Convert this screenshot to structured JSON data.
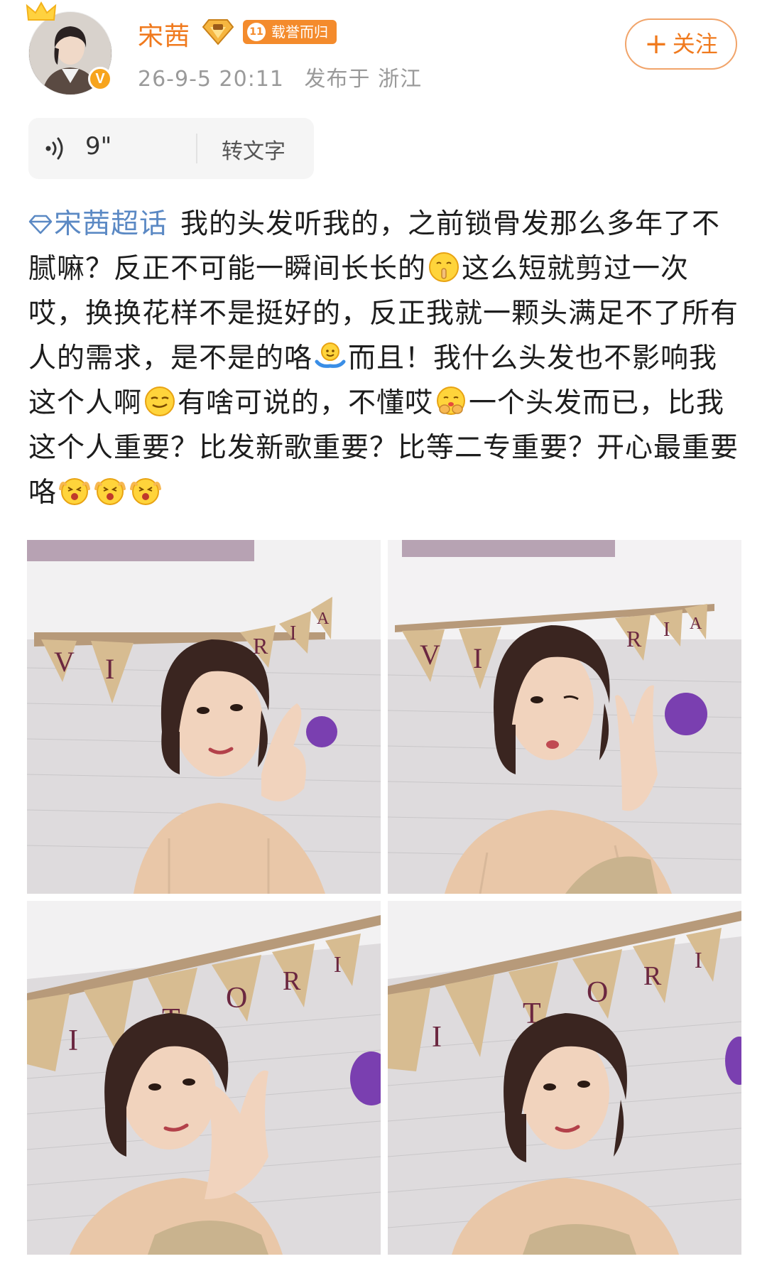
{
  "post": {
    "author": {
      "name": "宋茜",
      "honor_level": "11",
      "honor_label": "载誉而归",
      "verified_badge": "V"
    },
    "timestamp": "26-9-5 20:11",
    "location": "发布于 浙江",
    "follow_button": "+关注",
    "follow_label": "关注",
    "voice": {
      "duration": "9\"",
      "transcribe_label": "转文字"
    },
    "topic": "宋茜超话",
    "text_segments": [
      "我的头发听我的，之前锁骨发那么多年了不腻嘛？反正不可能一瞬间长长的",
      "这么短就剪过一次哎，换换花样不是挺好的，反正我就一颗头满足不了所有人的需求，是不是的咯",
      "而且！我什么头发也不影响我这个人啊",
      "有啥可说的，不懂哎",
      "一个头发而已，比我这个人重要？比发新歌重要？比等二专重要？开心最重要咯"
    ],
    "emojis": [
      "shush-emoji",
      "shrug-emoji",
      "smirk-emoji",
      "hug-emoji",
      "cheer-emoji",
      "cheer-emoji",
      "cheer-emoji"
    ],
    "banner_letters": {
      "photo1": [
        "V",
        "I",
        "R",
        "I",
        "A"
      ],
      "photo2": [
        "V",
        "I",
        "R",
        "I",
        "A"
      ],
      "photo3": [
        "I",
        "T",
        "O",
        "R",
        "I"
      ],
      "photo4": [
        "I",
        "T",
        "O",
        "R",
        "I"
      ]
    },
    "colors": {
      "username": "#f07a1e",
      "topic": "#5b89c4",
      "follow": "#f07a1e",
      "meta": "#9a9a9a"
    }
  }
}
